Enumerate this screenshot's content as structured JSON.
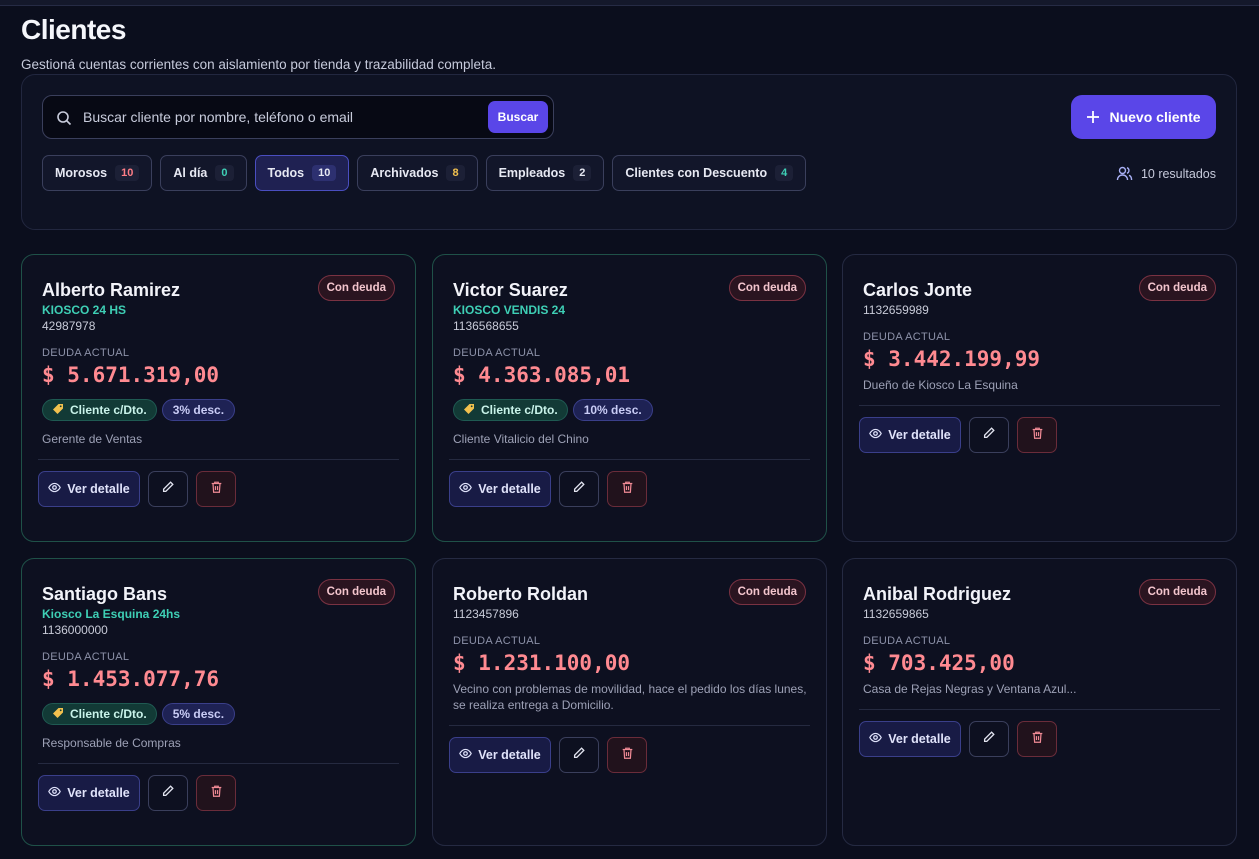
{
  "header": {
    "title": "Clientes",
    "subtitle": "Gestioná cuentas corrientes con aislamiento por tienda y trazabilidad completa."
  },
  "search": {
    "placeholder": "Buscar cliente por nombre, teléfono o email",
    "value": "",
    "button_label": "Buscar"
  },
  "new_client_label": "Nuevo cliente",
  "filters": [
    {
      "label": "Morosos",
      "count": "10",
      "color": "#ff7d86"
    },
    {
      "label": "Al día",
      "count": "0",
      "color": "#3ecfb5"
    },
    {
      "label": "Todos",
      "count": "10",
      "color": "#e7e9f3",
      "active": true
    },
    {
      "label": "Archivados",
      "count": "8",
      "color": "#f2c14e"
    },
    {
      "label": "Empleados",
      "count": "2",
      "color": "#e7e9f3"
    },
    {
      "label": "Clientes con Descuento",
      "count": "4",
      "color": "#3ecfb5"
    }
  ],
  "results_text": "10 resultados",
  "labels": {
    "debt_badge": "Con deuda",
    "debt_label": "DEUDA ACTUAL",
    "detail_button": "Ver detalle",
    "discount_tag": "Cliente c/Dto."
  },
  "clients": [
    {
      "name": "Alberto Ramirez",
      "store": "KIOSCO 24 HS",
      "phone": "42987978",
      "amount": "$ 5.671.319,00",
      "discount": "3% desc.",
      "note": "Gerente de Ventas"
    },
    {
      "name": "Victor Suarez",
      "store": "KIOSCO VENDIS 24",
      "phone": "1136568655",
      "amount": "$ 4.363.085,01",
      "discount": "10% desc.",
      "note": "Cliente Vitalicio del Chino"
    },
    {
      "name": "Carlos Jonte",
      "store": "",
      "phone": "1132659989",
      "amount": "$ 3.442.199,99",
      "discount": "",
      "note": "Dueño de Kiosco La Esquina"
    },
    {
      "name": "Santiago Bans",
      "store": "Kiosco La Esquina 24hs",
      "phone": "1136000000",
      "amount": "$ 1.453.077,76",
      "discount": "5% desc.",
      "note": "Responsable de Compras"
    },
    {
      "name": "Roberto Roldan",
      "store": "",
      "phone": "1123457896",
      "amount": "$ 1.231.100,00",
      "discount": "",
      "note": "Vecino con problemas de movilidad, hace el pedido los días lunes, se realiza entrega a Domicilio."
    },
    {
      "name": "Anibal Rodriguez",
      "store": "",
      "phone": "1132659865",
      "amount": "$ 703.425,00",
      "discount": "",
      "note": "Casa de Rejas Negras y Ventana Azul..."
    }
  ],
  "colors": {
    "accent": "#5a46e8",
    "debt": "#ff8a91",
    "store": "#3ecfb5"
  }
}
